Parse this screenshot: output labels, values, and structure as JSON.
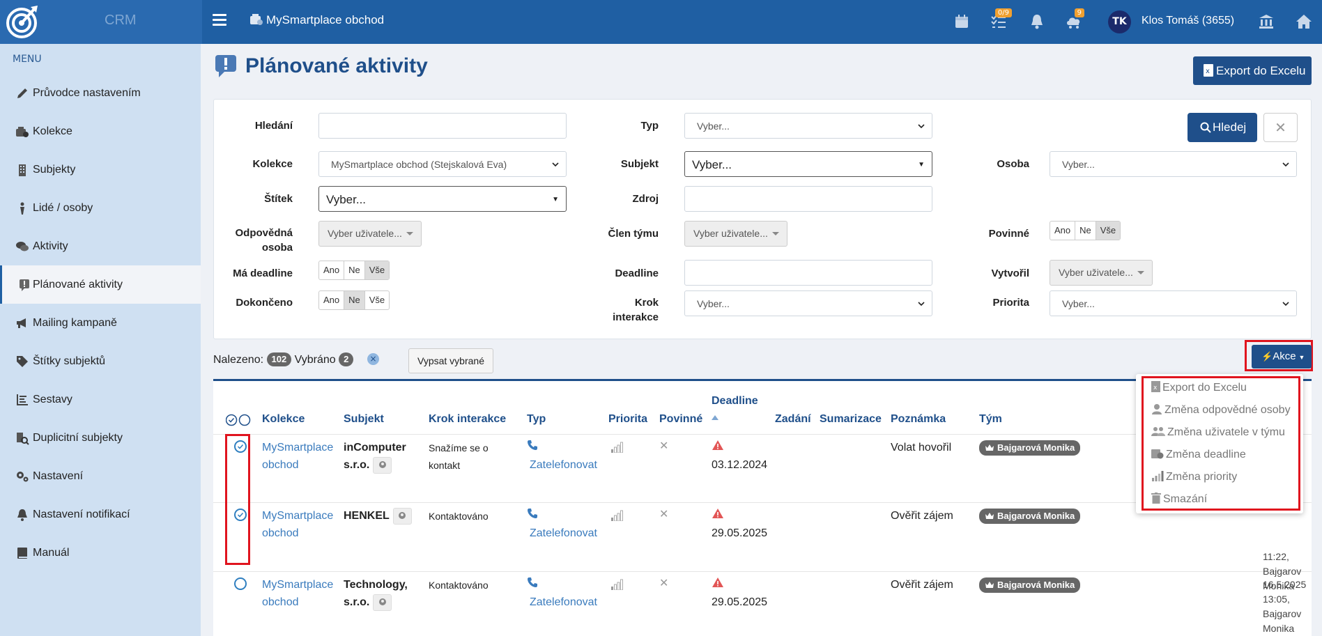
{
  "app": {
    "logo_text": "CRM",
    "collection_title": "MySmartplace obchod"
  },
  "header": {
    "tasks_badge": "0/9",
    "notifications_badge": "9",
    "avatar_initials": "TK",
    "user_name": "Klos Tomáš (3655)"
  },
  "sidebar": {
    "menu_label": "MENU",
    "items": [
      {
        "label": "Průvodce nastavením",
        "icon": "pencil-icon"
      },
      {
        "label": "Kolekce",
        "icon": "collection-icon"
      },
      {
        "label": "Subjekty",
        "icon": "building-icon"
      },
      {
        "label": "Lidé / osoby",
        "icon": "person-icon"
      },
      {
        "label": "Aktivity",
        "icon": "chat-icon"
      },
      {
        "label": "Plánované aktivity",
        "icon": "exclamation-icon",
        "active": true
      },
      {
        "label": "Mailing kampaně",
        "icon": "megaphone-icon"
      },
      {
        "label": "Štítky subjektů",
        "icon": "tag-icon"
      },
      {
        "label": "Sestavy",
        "icon": "list-icon"
      },
      {
        "label": "Duplicitní subjekty",
        "icon": "duplicate-search-icon"
      },
      {
        "label": "Nastavení",
        "icon": "cogs-icon"
      },
      {
        "label": "Nastavení notifikací",
        "icon": "bell-icon"
      },
      {
        "label": "Manuál",
        "icon": "book-icon"
      }
    ]
  },
  "page": {
    "title": "Plánované aktivity",
    "export_label": "Export do Excelu"
  },
  "filters": {
    "search_label": "Hledání",
    "type_label": "Typ",
    "type_value": "Vyber...",
    "search_button": "Hledej",
    "collection_label": "Kolekce",
    "collection_value": "MySmartplace obchod (Stejskalová Eva)",
    "subject_label": "Subjekt",
    "subject_value": "Vyber...",
    "person_label": "Osoba",
    "person_value": "Vyber...",
    "tag_label": "Štítek",
    "tag_value": "Vyber...",
    "source_label": "Zdroj",
    "responsible_label_1": "Odpovědná",
    "responsible_label_2": "osoba",
    "responsible_value": "Vyber uživatele...",
    "team_member_label": "Člen týmu",
    "team_member_value": "Vyber uživatele...",
    "mandatory_label": "Povinné",
    "has_deadline_label": "Má deadline",
    "deadline_label": "Deadline",
    "created_by_label": "Vytvořil",
    "created_by_value": "Vyber uživatele...",
    "completed_label": "Dokončeno",
    "step_label_1": "Krok",
    "step_label_2": "interakce",
    "step_value": "Vyber...",
    "priority_label": "Priorita",
    "priority_value": "Vyber...",
    "yes": "Ano",
    "no": "Ne",
    "all": "Vše"
  },
  "results": {
    "found_label": "Nalezeno:",
    "found_count": "102",
    "selected_label": "Vybráno",
    "selected_count": "2",
    "list_selected_button": "Vypsat vybrané",
    "actions_button": "Akce"
  },
  "actions_menu": [
    "Export do Excelu",
    "Změna odpovědné osoby",
    "Změna uživatele v týmu",
    "Změna deadline",
    "Změna priority",
    "Smazání"
  ],
  "table": {
    "headers": [
      "Kolekce",
      "Subjekt",
      "Krok interakce",
      "Typ",
      "Priorita",
      "Povinné",
      "Deadline",
      "Zadání",
      "Sumarizace",
      "Poznámka",
      "Tým"
    ],
    "rows": [
      {
        "collection_1": "MySmartplace",
        "collection_2": "obchod",
        "subject_1": "inComputer",
        "subject_2": "s.r.o.",
        "step_1": "Snažíme se o",
        "step_2": "kontakt",
        "type": "Zatelefonovat",
        "deadline": "03.12.2024",
        "note": "Volat hovořil",
        "team": "Bajgarová Monika",
        "selected": true,
        "extra": []
      },
      {
        "collection_1": "MySmartplace",
        "collection_2": "obchod",
        "subject_1": "HENKEL",
        "subject_2": "",
        "step_1": "Kontaktováno",
        "step_2": "",
        "type": "Zatelefonovat",
        "deadline": "29.05.2025",
        "note": "Ověřit zájem",
        "team": "Bajgarová Monika",
        "selected": true,
        "extra": [
          "11:22,",
          "Bajgarov",
          "Monika"
        ]
      },
      {
        "collection_1": "MySmartplace",
        "collection_2": "obchod",
        "subject_1": "Technology,",
        "subject_2": "s.r.o.",
        "step_1": "Kontaktováno",
        "step_2": "",
        "type": "Zatelefonovat",
        "deadline": "29.05.2025",
        "note": "Ověřit zájem",
        "team": "Bajgarová Monika",
        "selected": false,
        "extra": [
          "16.5.2025",
          "13:05,",
          "Bajgarov",
          "Monika"
        ]
      }
    ]
  },
  "colors": {
    "primary": "#1f4f8a",
    "header": "#1f5fa3",
    "sidebar": "#cfe0f2",
    "highlight": "#e0141e",
    "link": "#3a7bbd"
  }
}
